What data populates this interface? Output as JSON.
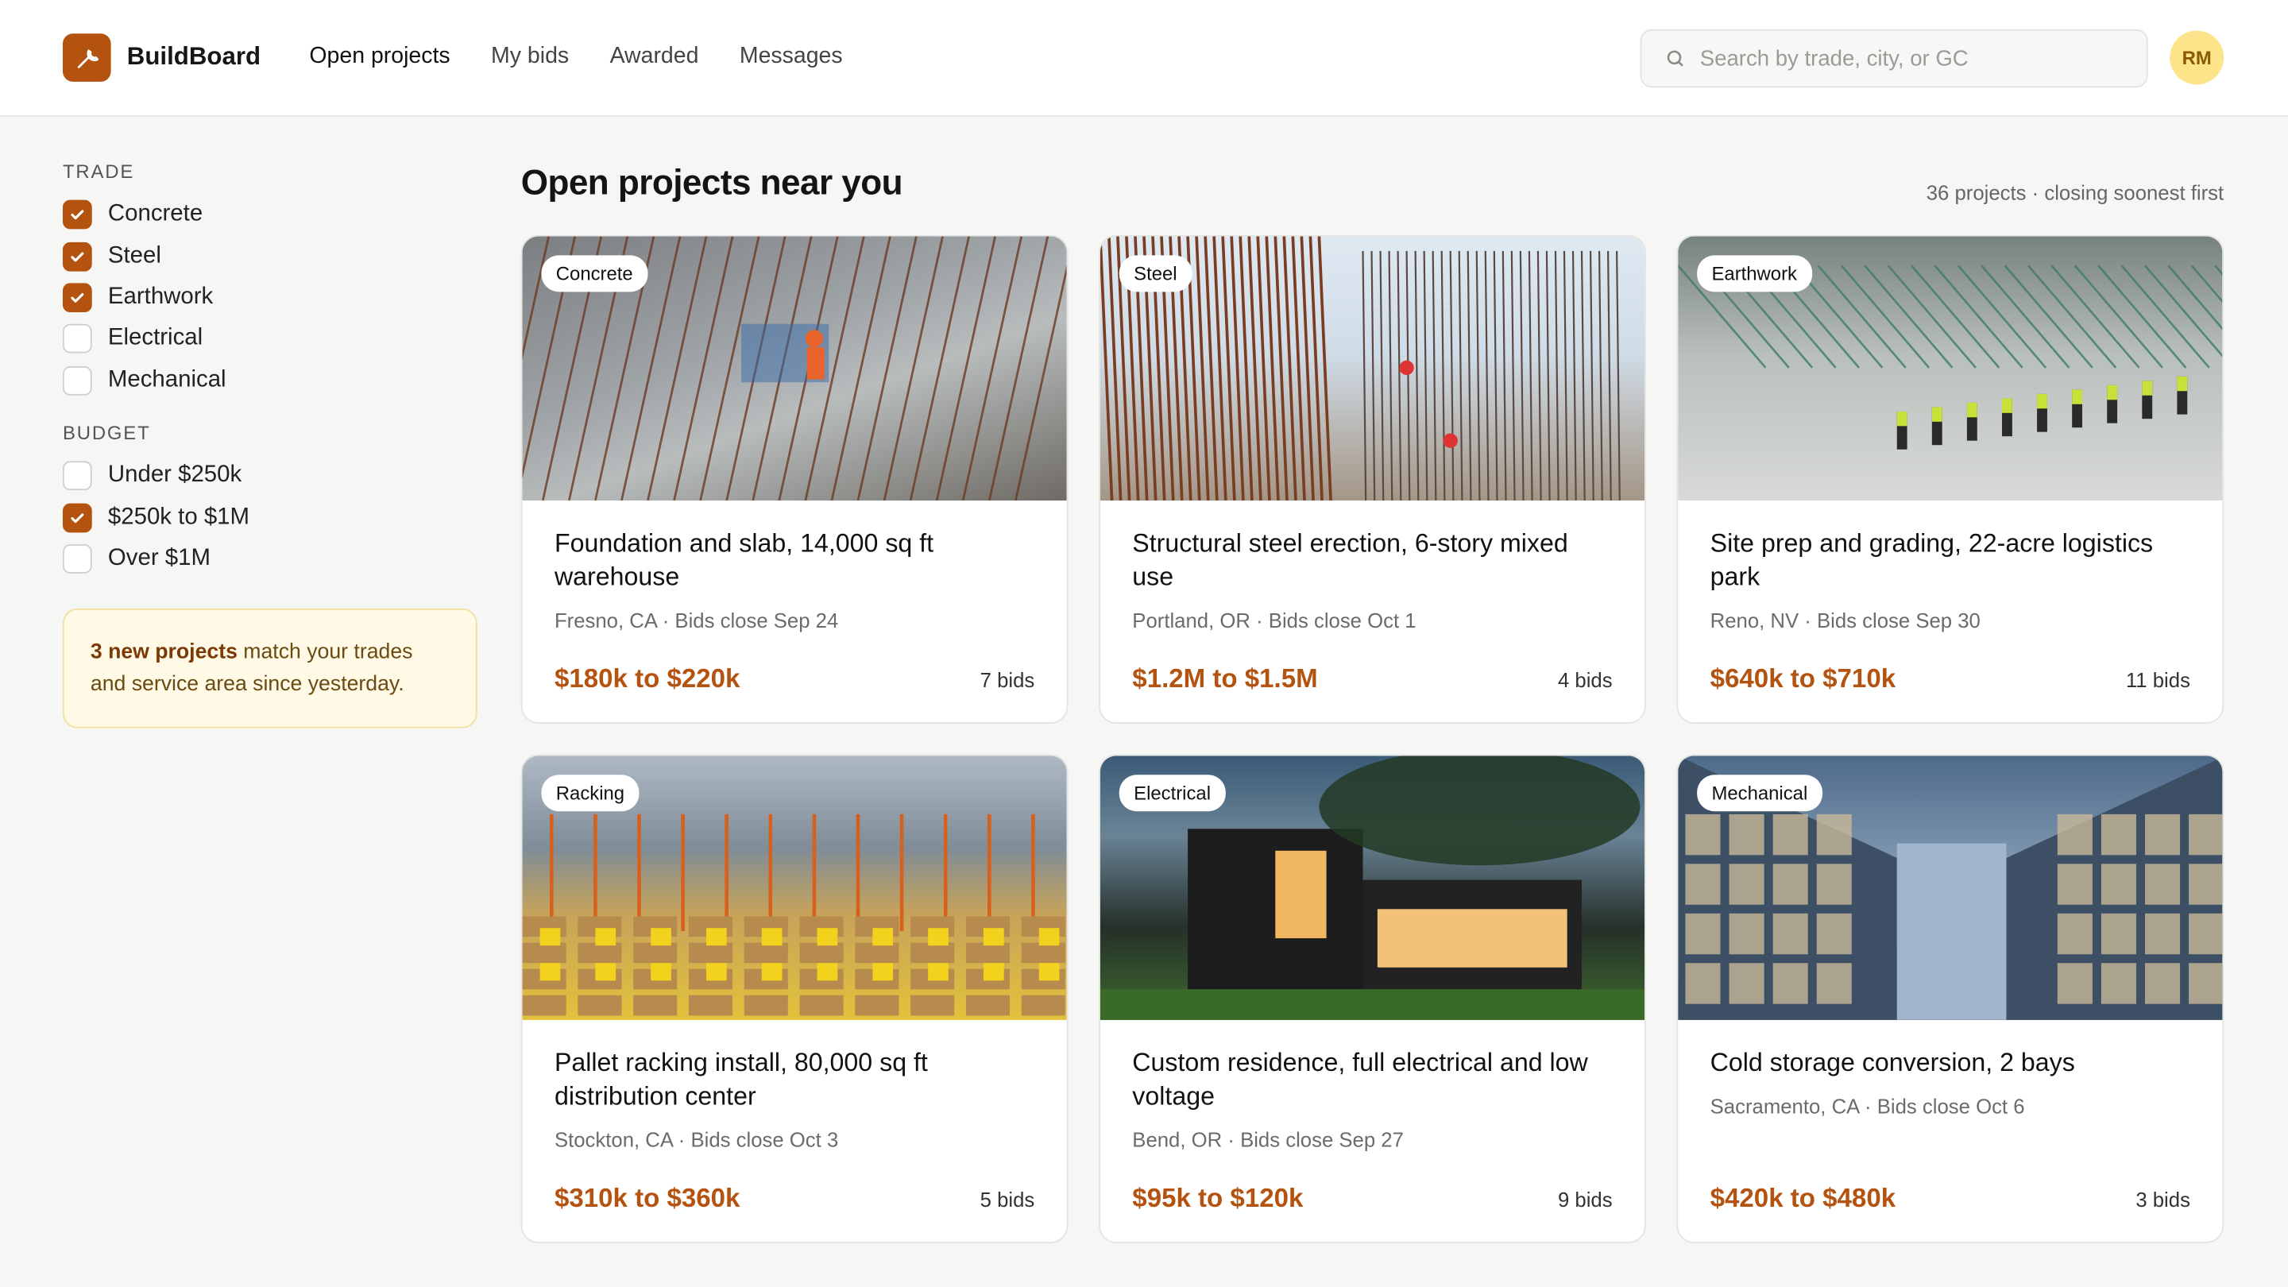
{
  "app": {
    "brand": "BuildBoard",
    "accent": "#b4520f"
  },
  "nav": {
    "items": [
      {
        "label": "Open projects",
        "active": true
      },
      {
        "label": "My bids"
      },
      {
        "label": "Awarded"
      },
      {
        "label": "Messages"
      }
    ]
  },
  "search": {
    "placeholder": "Search by trade, city, or GC",
    "value": ""
  },
  "user": {
    "initials": "RM"
  },
  "filters": {
    "trade": {
      "title": "TRADE",
      "options": [
        {
          "label": "Concrete",
          "checked": true
        },
        {
          "label": "Steel",
          "checked": true
        },
        {
          "label": "Earthwork",
          "checked": true
        },
        {
          "label": "Electrical",
          "checked": false
        },
        {
          "label": "Mechanical",
          "checked": false
        }
      ]
    },
    "budget": {
      "title": "BUDGET",
      "options": [
        {
          "label": "Under $250k",
          "checked": false
        },
        {
          "label": "$250k to $1M",
          "checked": true
        },
        {
          "label": "Over $1M",
          "checked": false
        }
      ]
    }
  },
  "notice": {
    "bold": "3 new projects",
    "text": " match your trades and service area since yesterday."
  },
  "main": {
    "title": "Open projects near you",
    "meta": "36 projects · closing soonest first"
  },
  "projects": [
    {
      "tag": "Concrete",
      "title": "Foundation and slab, 14,000 sq ft warehouse",
      "location": "Fresno, CA · Bids close Sep 24",
      "price": "$180k to $220k",
      "bids": "7 bids",
      "art": "concrete"
    },
    {
      "tag": "Steel",
      "title": "Structural steel erection, 6-story mixed use",
      "location": "Portland, OR · Bids close Oct 1",
      "price": "$1.2M to $1.5M",
      "bids": "4 bids",
      "art": "steel"
    },
    {
      "tag": "Earthwork",
      "title": "Site prep and grading, 22-acre logistics park",
      "location": "Reno, NV · Bids close Sep 30",
      "price": "$640k to $710k",
      "bids": "11 bids",
      "art": "earth"
    },
    {
      "tag": "Racking",
      "title": "Pallet racking install, 80,000 sq ft distribution center",
      "location": "Stockton, CA · Bids close Oct 3",
      "price": "$310k to $360k",
      "bids": "5 bids",
      "art": "rack"
    },
    {
      "tag": "Electrical",
      "title": "Custom residence, full electrical and low voltage",
      "location": "Bend, OR · Bids close Sep 27",
      "price": "$95k to $120k",
      "bids": "9 bids",
      "art": "elec"
    },
    {
      "tag": "Mechanical",
      "title": "Cold storage conversion, 2 bays",
      "location": "Sacramento, CA · Bids close Oct 6",
      "price": "$420k to $480k",
      "bids": "3 bids",
      "art": "mech"
    }
  ]
}
